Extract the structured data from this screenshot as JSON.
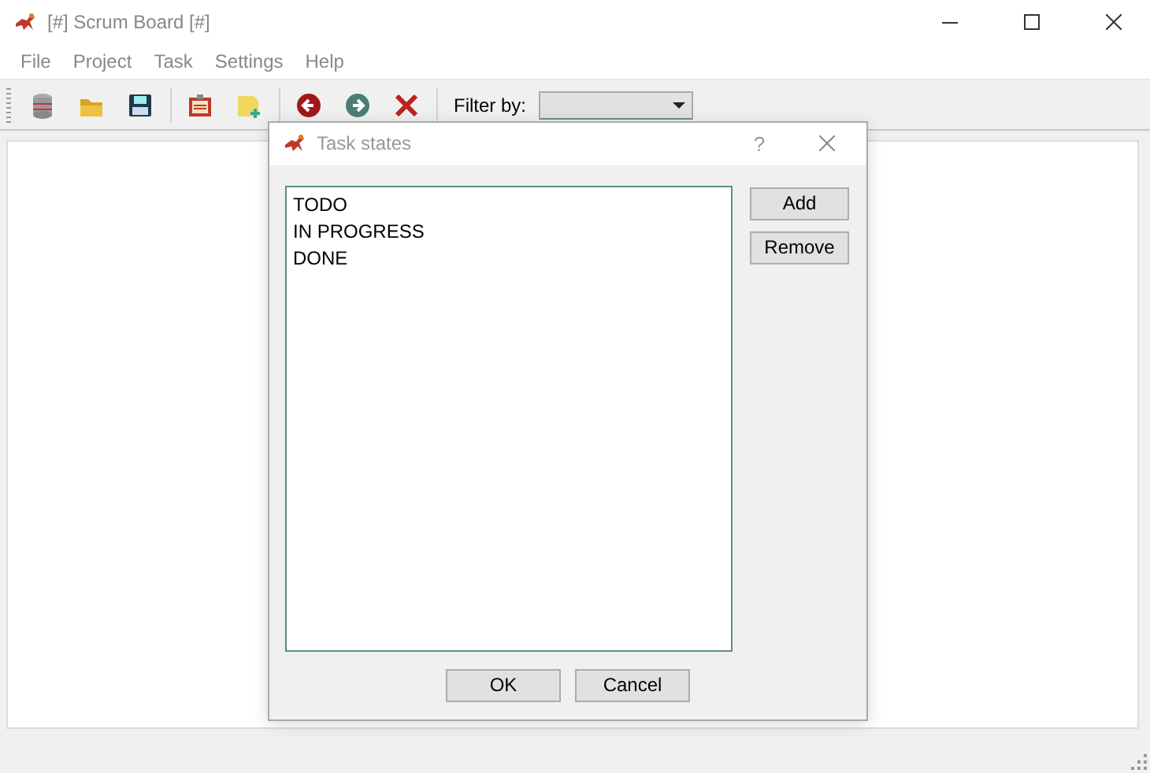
{
  "window": {
    "title": "[#] Scrum Board [#]"
  },
  "menu": [
    "File",
    "Project",
    "Task",
    "Settings",
    "Help"
  ],
  "toolbar": {
    "filter_label": "Filter by:"
  },
  "dialog": {
    "title": "Task states",
    "help": "?",
    "items": [
      "TODO",
      "IN PROGRESS",
      "DONE"
    ],
    "side_buttons": [
      "Add",
      "Remove"
    ],
    "buttons": [
      "OK",
      "Cancel"
    ]
  }
}
